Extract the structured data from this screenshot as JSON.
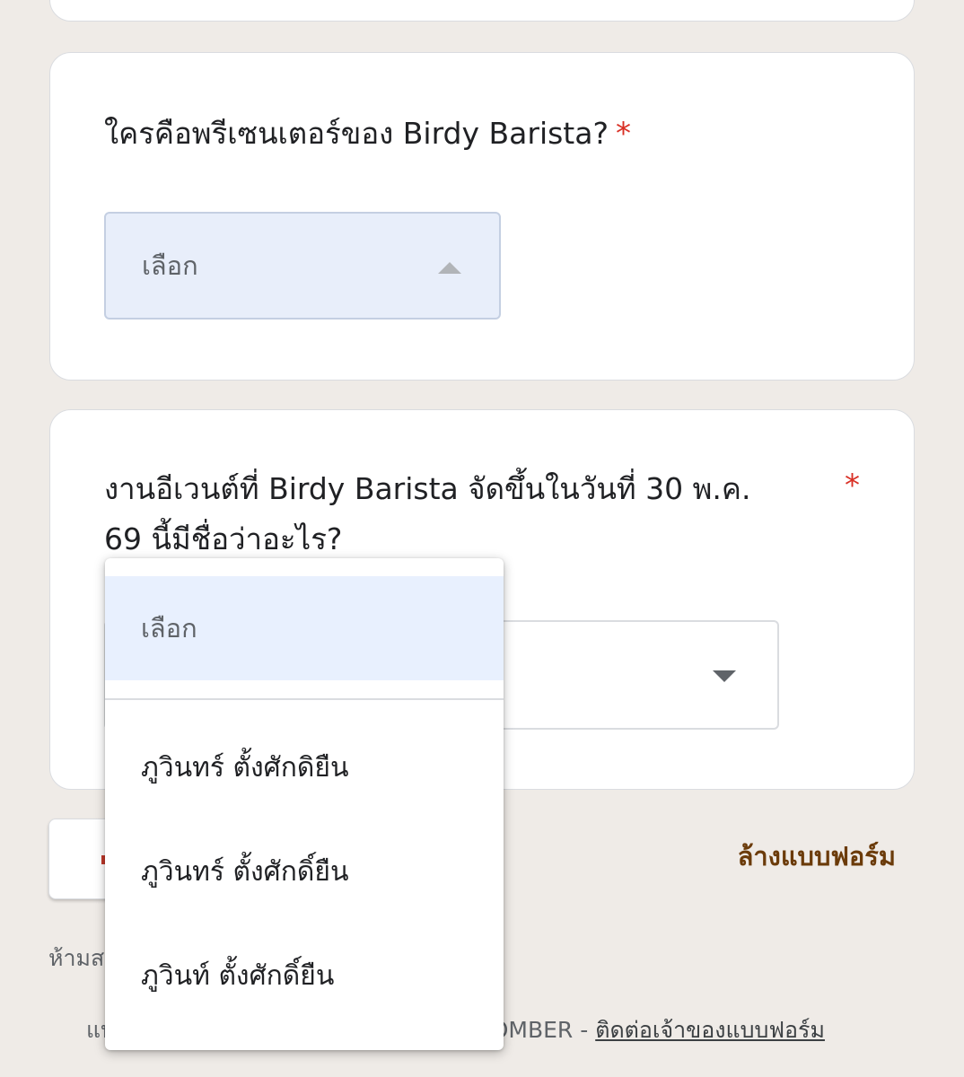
{
  "question1": {
    "text": "ใครคือพรีเซนเตอร์ของ Birdy Barista?",
    "required_mark": "*",
    "select": {
      "placeholder": "เลือก",
      "state": "open"
    }
  },
  "question2": {
    "text": "งานอีเวนต์ที่ Birdy Barista จัดขึ้นในวันที่ 30 พ.ค. 69 นี้มีชื่อว่าอะไร?",
    "required_mark": "*"
  },
  "dropdown": {
    "placeholder": "เลือก",
    "options": [
      {
        "label": "ภูวินทร์ ตั้งศักดิยืน"
      },
      {
        "label": "ภูวินทร์ ตั้งศักดิ์ยืน"
      },
      {
        "label": "ภูวินท์ ตั้งศักดิ์ยืน"
      }
    ]
  },
  "actions": {
    "clear_form": "ล้างแบบฟอร์ม"
  },
  "footer": {
    "warning_partial": "ห้ามส",
    "owner_partial_left": "แบ",
    "owner_partial_right": "BOMBER - ",
    "contact_owner": "ติดต่อเจ้าของแบบฟอร์ม"
  },
  "colors": {
    "background": "#efebe7",
    "required": "#d93025",
    "accent_link": "#6b3b0a",
    "selected_fill": "#e8eefa"
  }
}
